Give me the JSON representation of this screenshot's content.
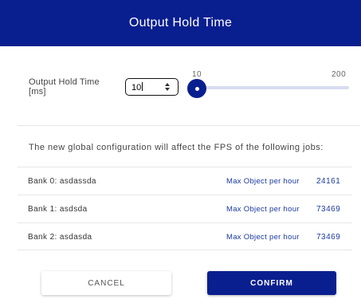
{
  "header": {
    "title": "Output Hold Time"
  },
  "setting": {
    "label": "Output Hold Time [ms]",
    "input_value": "10",
    "slider": {
      "min_label": "10",
      "max_label": "200",
      "min": 10,
      "max": 200,
      "value": 10
    }
  },
  "info": {
    "text": "The new global configuration will affect the FPS of the following jobs:"
  },
  "jobs": [
    {
      "name": "Bank 0: asdassda",
      "metric": "Max Object per hour",
      "value": "24161"
    },
    {
      "name": "Bank 1: asdsda",
      "metric": "Max Object per hour",
      "value": "73469"
    },
    {
      "name": "Bank 2: asdasda",
      "metric": "Max Object per hour",
      "value": "73469"
    }
  ],
  "buttons": {
    "cancel": "CANCEL",
    "confirm": "CONFIRM"
  },
  "colors": {
    "primary": "#0a1f8f",
    "track": "#d8dcf1",
    "link": "#1a3a9e"
  }
}
